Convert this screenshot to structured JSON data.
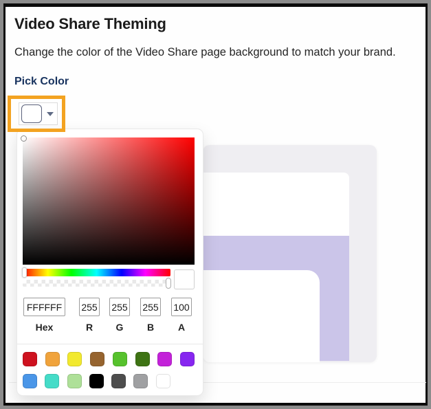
{
  "page": {
    "title": "Video Share Theming",
    "subtitle": "Change the color of the Video Share page background to match your brand.",
    "section_label": "Pick Color"
  },
  "color_button": {
    "selected_color": "#FFFFFF",
    "annotation_highlight_color": "#F3A321"
  },
  "preview": {
    "card_bg": "#EFEEF2",
    "header_bg": "#FFFFFF",
    "background_accent": "#CBC5E9",
    "content_bg": "#FFFFFF"
  },
  "popup": {
    "hue_color": "#FF0000",
    "current_color": "#FFFFFF",
    "fields": [
      {
        "label": "Hex",
        "value": "FFFFFF"
      },
      {
        "label": "R",
        "value": "255"
      },
      {
        "label": "G",
        "value": "255"
      },
      {
        "label": "B",
        "value": "255"
      },
      {
        "label": "A",
        "value": "100"
      }
    ],
    "palette": {
      "row1": [
        "#CE121F",
        "#F0A33C",
        "#F2E92F",
        "#96642F",
        "#57C22D",
        "#3E7314",
        "#C322D9",
        "#8726F0"
      ],
      "row2": [
        "#4A96E8",
        "#45DCC8",
        "#AEE098",
        "#000000",
        "#4D4D4D",
        "#9FA0A2",
        "#FFFFFF"
      ]
    }
  }
}
